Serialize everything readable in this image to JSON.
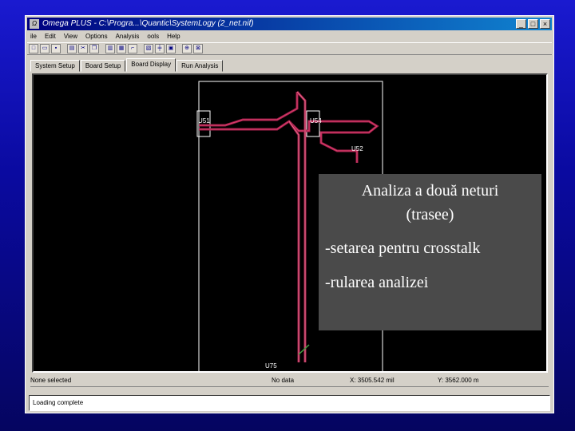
{
  "window": {
    "title": "Omega PLUS - C:\\Progra...\\Quantic\\SystemLogy (2_net.nif)",
    "app_icon": "app-icon",
    "buttons": [
      "_",
      "□",
      "×"
    ]
  },
  "menu": [
    "ile",
    "Edit",
    "View",
    "Options",
    "Analysis",
    "ools",
    "Help"
  ],
  "toolbar_icons": [
    "new-icon",
    "open-icon",
    "save-icon",
    "print-icon",
    "cut-icon",
    "copy-icon",
    "paste-icon",
    "board-icon",
    "route-icon",
    "layer-icon",
    "net-icon",
    "part-icon",
    "zoom-icon",
    "fit-icon"
  ],
  "tabs": [
    "System Setup",
    "Board Setup",
    "Board Display",
    "Run Analysis"
  ],
  "active_tab": 2,
  "schematic": {
    "labels": [
      "U51",
      "U54",
      "U52",
      "U75"
    ],
    "colors": {
      "trace": "#a0204a",
      "trace_light": "#f07090",
      "outline": "#ffffff",
      "diagonal": "#40a040"
    }
  },
  "status": {
    "selection": "None selected",
    "data": "No data",
    "x": "X: 3505.542 mil",
    "y": "Y: 3562.000 m"
  },
  "message": "Loading complete",
  "overlay": {
    "title_line1": "Analiza a două neturi",
    "title_line2": "(trasee)",
    "bullet1": "-setarea pentru crosstalk",
    "bullet2": "-rularea analizei"
  }
}
